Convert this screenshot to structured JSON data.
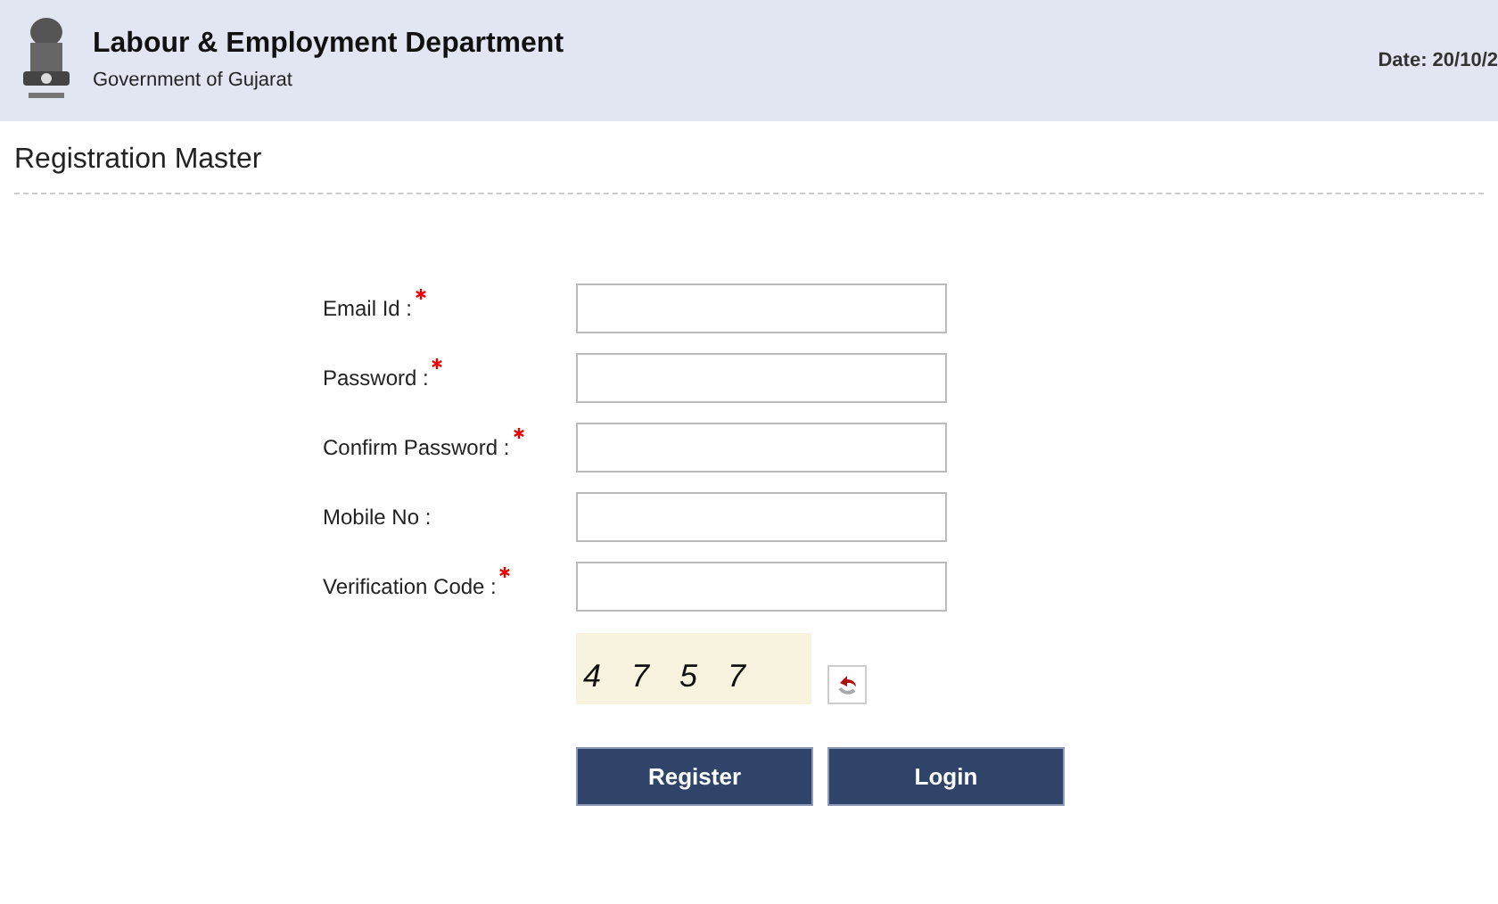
{
  "header": {
    "title": "Labour & Employment Department",
    "subtitle": "Government of Gujarat",
    "date": "Date: 20/10/2"
  },
  "page_title": "Registration Master",
  "fields": [
    {
      "label": "Email Id :",
      "required": true
    },
    {
      "label": "Password :",
      "required": true
    },
    {
      "label": "Confirm Password :",
      "required": true
    },
    {
      "label": "Mobile No :",
      "required": false
    },
    {
      "label": "Verification Code :",
      "required": true
    }
  ],
  "captcha": {
    "code": "4 7 5 7"
  },
  "buttons": [
    "Register",
    "Login"
  ]
}
